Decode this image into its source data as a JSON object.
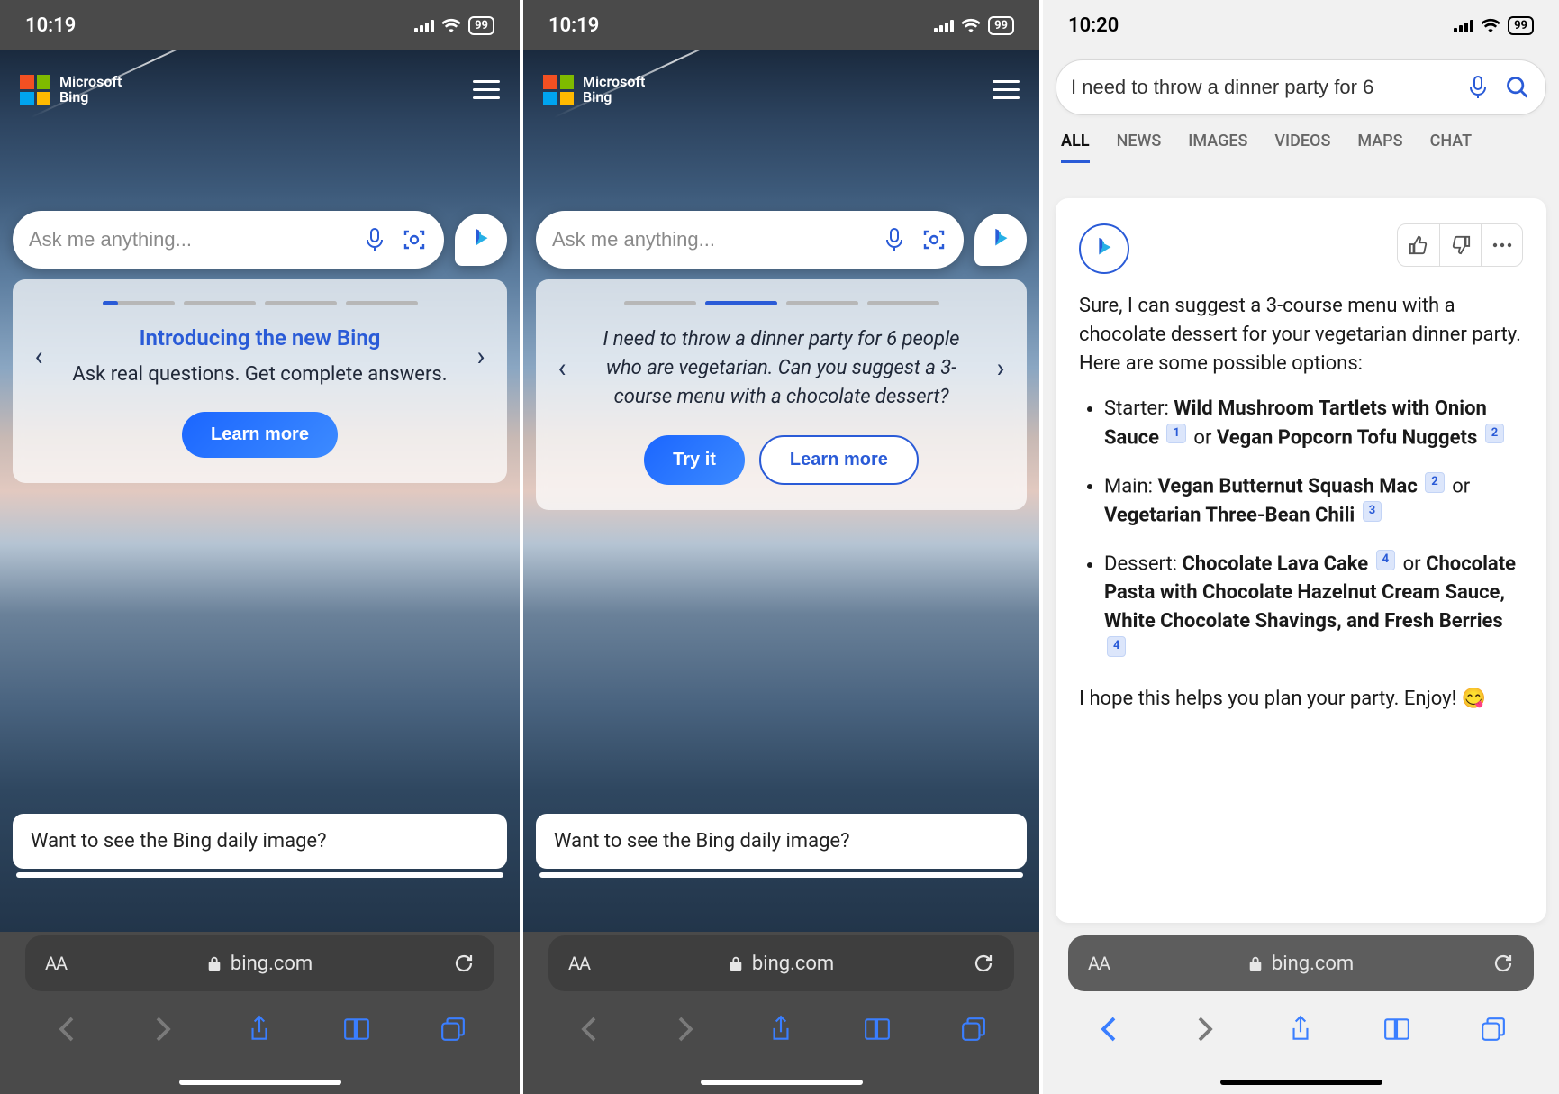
{
  "status": {
    "time1": "10:19",
    "time2": "10:19",
    "time3": "10:20",
    "battery": "99"
  },
  "brand": {
    "line1": "Microsoft",
    "line2": "Bing"
  },
  "search": {
    "placeholder": "Ask me anything..."
  },
  "card1": {
    "title": "Introducing the new Bing",
    "subtitle": "Ask real questions. Get complete answers.",
    "learn_more": "Learn more"
  },
  "card2": {
    "quote": "I need to throw a dinner party for 6 people who are vegetarian. Can you suggest a 3-course menu with a chocolate dessert?",
    "try_it": "Try it",
    "learn_more": "Learn more"
  },
  "daily_prompt": "Want to see the Bing daily image?",
  "url": "bing.com",
  "aa": "AA",
  "search3": {
    "value": "I need to throw a dinner party for 6"
  },
  "tabs": {
    "all": "ALL",
    "news": "NEWS",
    "images": "IMAGES",
    "videos": "VIDEOS",
    "maps": "MAPS",
    "chat": "CHAT"
  },
  "response": {
    "intro": "Sure, I can suggest a 3-course menu with a chocolate dessert for your vegetarian dinner party. Here are some possible options:",
    "items": [
      {
        "label": "Starter:",
        "opt1": "Wild Mushroom Tartlets with Onion Sauce",
        "c1": "1",
        "or": " or ",
        "opt2": "Vegan Popcorn Tofu Nuggets",
        "c2": "2"
      },
      {
        "label": "Main:",
        "opt1": "Vegan Butternut Squash Mac",
        "c1": "2",
        "or": " or ",
        "opt2": "Vegetarian Three-Bean Chili",
        "c2": "3"
      },
      {
        "label": "Dessert:",
        "opt1": "Chocolate Lava Cake",
        "c1": "4",
        "or": " or ",
        "opt2": "Chocolate Pasta with Chocolate Hazelnut Cream Sauce, White Chocolate Shavings, and Fresh Berries",
        "c2": "4"
      }
    ],
    "outro": "I hope this helps you plan your party. Enjoy! 😋"
  }
}
